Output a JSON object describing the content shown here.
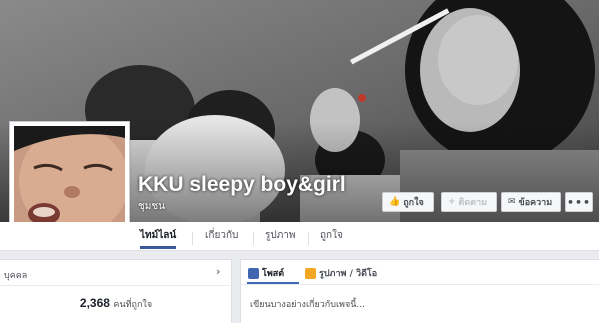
{
  "page": {
    "name": "KKU sleepy boy&girl",
    "category": "ชุมชน"
  },
  "actions": {
    "like_label": "ถูกใจ",
    "follow_label": "ติดตาม",
    "message_label": "ข้อความ",
    "more_label": "•••"
  },
  "tabs": [
    {
      "label": "ไทม์ไลน์",
      "active": true
    },
    {
      "label": "เกี่ยวกับ",
      "active": false
    },
    {
      "label": "รูปภาพ",
      "active": false
    },
    {
      "label": "ถูกใจ",
      "active": false
    }
  ],
  "left_card": {
    "title": "บุคคล",
    "likes_count": "2,368",
    "likes_label": "คนที่ถูกใจ"
  },
  "composer": {
    "tab_post": "โพสต์",
    "tab_photo_video": "รูปภาพ / วิดีโอ",
    "placeholder": "เขียนบางอย่างเกี่ยวกับเพจนี้..."
  },
  "colors": {
    "accent": "#3b5998",
    "button_border": "#ccd0d5",
    "background": "#e9ebee"
  },
  "icons": [
    "thumbs-up-icon",
    "plus-icon",
    "chat-icon",
    "more-dots-icon",
    "post-icon",
    "photo-icon",
    "chevron-right-icon"
  ]
}
